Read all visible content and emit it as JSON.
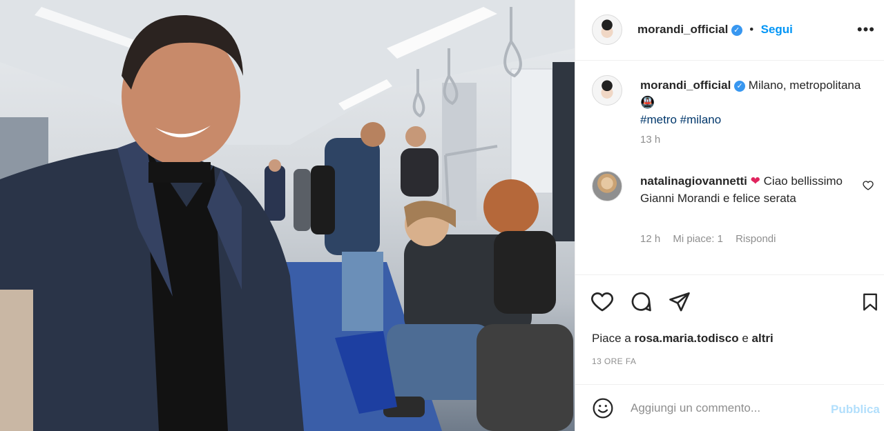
{
  "post": {
    "author": "morandi_official",
    "follow_label": "Segui",
    "separator": "•",
    "more_label": "•••"
  },
  "caption": {
    "author": "morandi_official",
    "text": "Milano, metropolitana",
    "emoji": "🚇",
    "hashtags": [
      "#metro",
      "#milano"
    ],
    "time": "13 h"
  },
  "comments": [
    {
      "author": "natalinagiovannetti",
      "heart": "❤",
      "text": "Ciao bellissimo Gianni Morandi e felice serata",
      "time": "12 h",
      "likes": "Mi piace: 1",
      "reply": "Rispondi"
    }
  ],
  "likes": {
    "prefix": "Piace a",
    "user": "rosa.maria.todisco",
    "connector": "e",
    "others": "altri"
  },
  "timestamp": "13 ORE FA",
  "add_comment": {
    "placeholder": "Aggiungi un commento...",
    "publish_label": "Pubblica"
  },
  "colors": {
    "link_blue": "#0095f6",
    "verified_blue": "#3897f0",
    "publish_disabled": "#b2dffc",
    "muted_text": "#8e8e8e",
    "hashtag": "#00376b"
  }
}
